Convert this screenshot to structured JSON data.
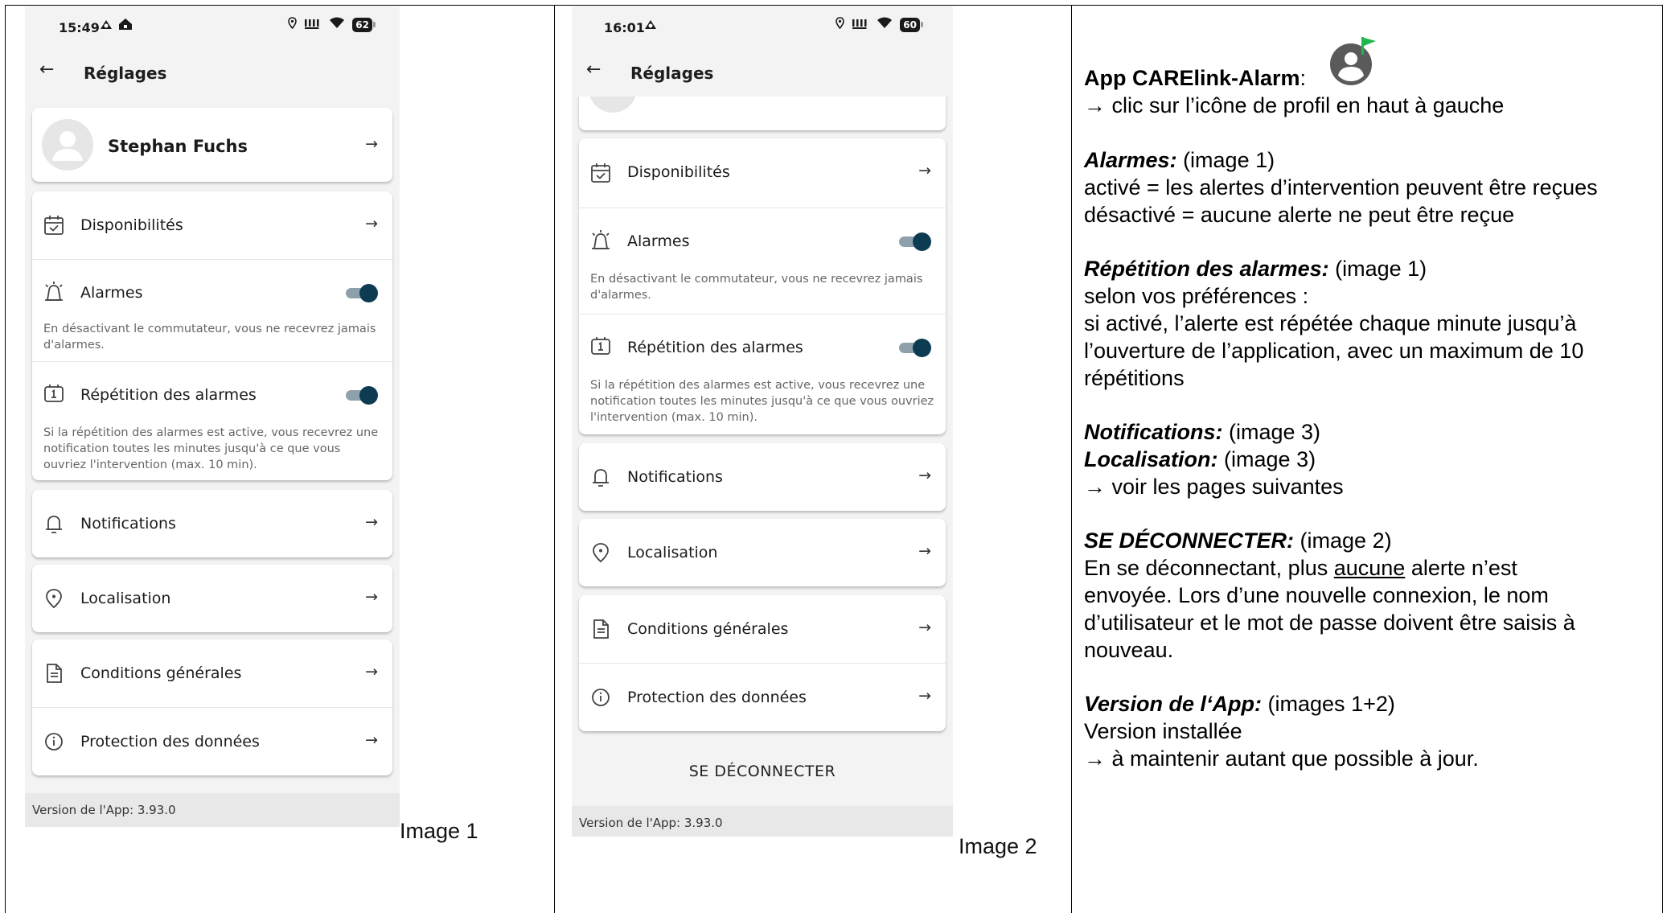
{
  "image1": {
    "status": {
      "time": "15:49",
      "battery": "62"
    },
    "appbar_title": "Réglages",
    "profile_name": "Stephan Fuchs",
    "rows": {
      "availability": "Disponibilités",
      "alarms": "Alarmes",
      "alarms_desc": "En désactivant le commutateur, vous ne recevrez jamais d'alarmes.",
      "repeat": "Répétition des alarmes",
      "repeat_desc": "Si la répétition des alarmes est active, vous recevrez une notification toutes les minutes jusqu'à ce que vous ouvriez l'intervention (max. 10 min).",
      "notifications": "Notifications",
      "location": "Localisation",
      "terms": "Conditions générales",
      "privacy": "Protection des données"
    },
    "toggles": {
      "alarms_on": true,
      "repeat_on": true
    },
    "version": "Version de l'App: 3.93.0",
    "caption": "Image 1"
  },
  "image2": {
    "status": {
      "time": "16:01",
      "battery": "60"
    },
    "appbar_title": "Réglages",
    "rows": {
      "availability": "Disponibilités",
      "alarms": "Alarmes",
      "alarms_desc": "En désactivant le commutateur, vous ne recevrez jamais d'alarmes.",
      "repeat": "Répétition des alarmes",
      "repeat_desc": "Si la répétition des alarmes est active, vous recevrez une notification toutes les minutes jusqu'à ce que vous ouvriez l'intervention (max. 10 min).",
      "notifications": "Notifications",
      "location": "Localisation",
      "terms": "Conditions générales",
      "privacy": "Protection des données"
    },
    "toggles": {
      "alarms_on": true,
      "repeat_on": true
    },
    "logout": "SE DÉCONNECTER",
    "version": "Version de l'App: 3.93.0",
    "caption": "Image 2"
  },
  "notes": {
    "app_title": "App CARElink-Alarm",
    "app_colon": ":",
    "app_hint": "→ clic sur l’icône de profil en haut à gauche",
    "alarms_head": "Alarmes:",
    "alarms_ref": " (image 1)",
    "alarms_l1": "activé = les alertes d’intervention peuvent être reçues",
    "alarms_l2": "désactivé = aucune alerte ne peut être reçue",
    "repeat_head": "Répétition des alarmes:",
    "repeat_ref": " (image 1)",
    "repeat_l1": "selon vos préférences :",
    "repeat_l2": "si activé, l’alerte est répétée chaque minute jusqu’à",
    "repeat_l3": "l’ouverture de l’application,  avec un maximum de 10",
    "repeat_l4": "répétitions",
    "notif_head": "Notifications:",
    "notif_ref": " (image 3)",
    "loc_head": "Localisation:",
    "loc_ref": " (image 3)",
    "see_next": "→ voir les pages suivantes",
    "logout_head": "SE DÉCONNECTER:",
    "logout_ref": " (image 2)",
    "logout_l1a": "En se déconnectant, plus ",
    "logout_l1u": "aucune",
    "logout_l1b": " alerte n’est",
    "logout_l2": "envoyée. Lors d’une nouvelle connexion, le nom",
    "logout_l3": "d’utilisateur et le mot de passe doivent être saisis à",
    "logout_l4": "nouveau.",
    "version_head": "Version de l‘App:",
    "version_ref": " (images 1+2)",
    "version_l1": "Version installée",
    "version_l2": "→ à maintenir autant que possible à jour."
  },
  "colors": {
    "toggle_knob": "#0d3c52",
    "toggle_track": "#8ea1ab",
    "brand_icon": "#5a5a5a",
    "brand_flag": "#1fb64a"
  }
}
